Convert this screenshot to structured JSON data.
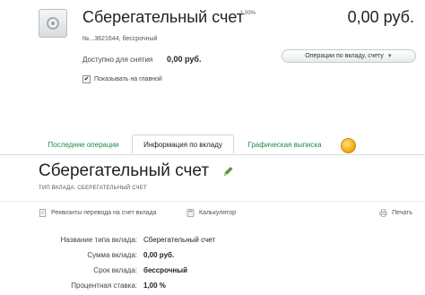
{
  "account": {
    "title": "Сберегательный счет",
    "rate_superscript": "1,00%",
    "balance": "0,00 руб.",
    "number_line": "№...3621644, бессрочный",
    "available_label": "Доступно для снятия",
    "available_value": "0,00 руб.",
    "operations_button": "Операции по вкладу, счету",
    "show_on_main_label": "Показывать на главной",
    "show_on_main_checked": true
  },
  "tabs": [
    {
      "label": "Последние операции",
      "active": false
    },
    {
      "label": "Информация по вкладу",
      "active": true
    },
    {
      "label": "Графическая выписка",
      "active": false
    }
  ],
  "deposit": {
    "title": "Сберегательный счет",
    "type_line": "ТИП ВКЛАДА: СБЕРЕГАТЕЛЬНЫЙ СЧЕТ",
    "actions": {
      "transfer_details": "Реквизиты перевода на счет вклада",
      "calculator": "Калькулятор",
      "print": "Печать"
    },
    "details": [
      {
        "label": "Название типа вклада:",
        "value": "Сберегательный счет",
        "bold": false
      },
      {
        "label": "Сумма вклада:",
        "value": "0,00 руб.",
        "bold": true
      },
      {
        "label": "Срок вклада:",
        "value": "бессрочный",
        "bold": true
      },
      {
        "label": "Процентная ставка:",
        "value": "1,00 %",
        "bold": true
      }
    ]
  },
  "icons": {
    "account": "safe-icon",
    "tab_extra": "coin-icon",
    "edit": "pencil-icon",
    "transfer": "document-icon",
    "calculator": "calculator-icon",
    "print": "printer-icon"
  },
  "colors": {
    "tab_link": "#1f8a4c",
    "coin": "#f4a20d",
    "pencil": "#5aa032"
  }
}
